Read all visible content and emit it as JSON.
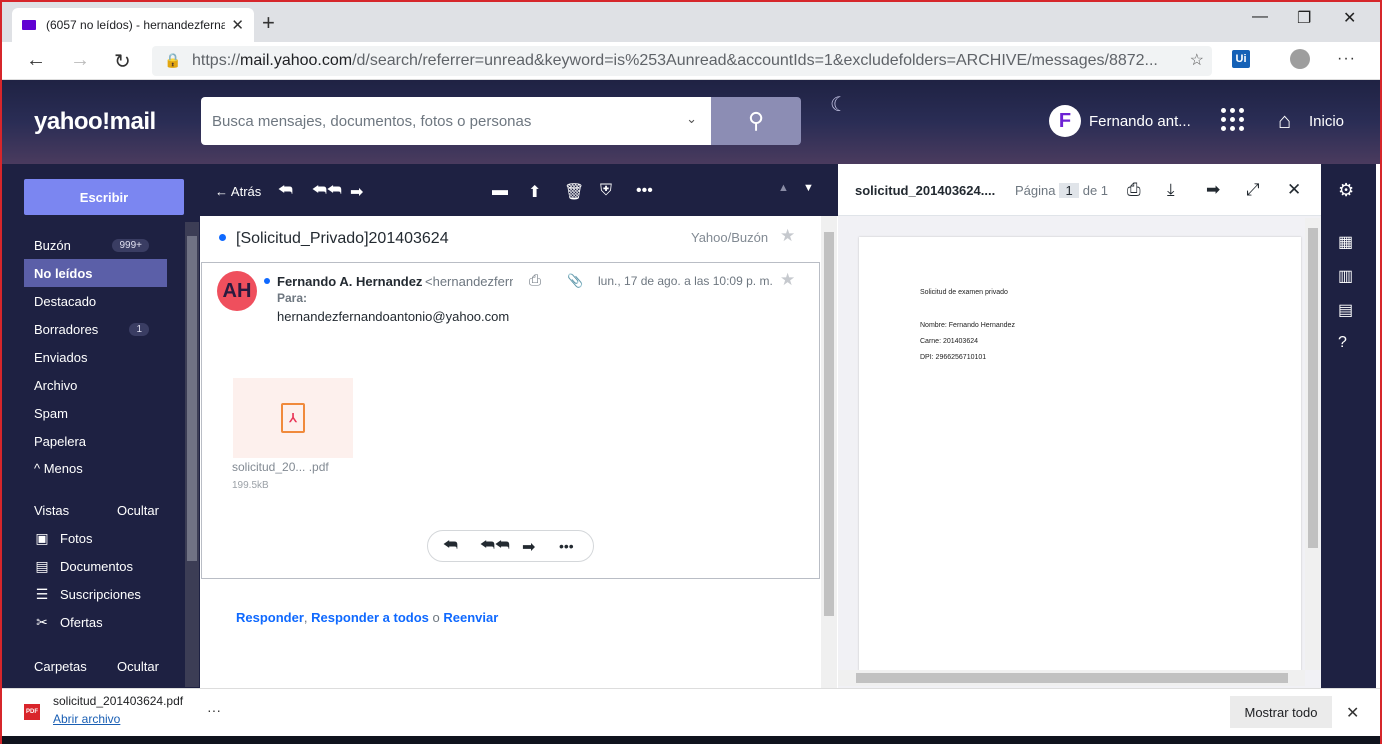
{
  "browser": {
    "tab_title": "(6057 no leídos) - hernandezferna",
    "url_prefix": "https://",
    "url_host": "mail.yahoo.com",
    "url_path": "/d/search/referrer=unread&keyword=is%253Aunread&accountIds=1&excludefolders=ARCHIVE/messages/8872...",
    "ext_label": "Ui"
  },
  "header": {
    "logo": "yahoo!mail",
    "search_placeholder": "Busca mensajes, documentos, fotos o personas",
    "user_name": "Fernando ant...",
    "user_initial": "F",
    "home_label": "Inicio"
  },
  "sidebar": {
    "compose": "Escribir",
    "folders": [
      {
        "label": "Buzón",
        "count": "999+"
      },
      {
        "label": "No leídos",
        "count": ""
      },
      {
        "label": "Destacado",
        "count": ""
      },
      {
        "label": "Borradores",
        "count": "1"
      },
      {
        "label": "Enviados",
        "count": ""
      },
      {
        "label": "Archivo",
        "count": ""
      },
      {
        "label": "Spam",
        "count": ""
      },
      {
        "label": "Papelera",
        "count": ""
      }
    ],
    "less": "^ Menos",
    "views_label": "Vistas",
    "hide_label": "Ocultar",
    "views": [
      {
        "label": "Fotos"
      },
      {
        "label": "Documentos"
      },
      {
        "label": "Suscripciones"
      },
      {
        "label": "Ofertas"
      }
    ],
    "folders_label": "Carpetas",
    "folders_hide": "Ocultar"
  },
  "toolbar": {
    "back": "Atrás"
  },
  "message": {
    "subject": "[Solicitud_Privado]201403624",
    "folder": "Yahoo/Buzón",
    "sender_name": "Fernando A. Hernandez",
    "sender_email": "<hernandezfernandoantonio@yahoo.com>",
    "to_label": "Para:",
    "to_address": "hernandezfernandoantonio@yahoo.com",
    "date": "lun., 17 de ago. a las 10:09 p. m.",
    "avatar_initials": "AH",
    "attachment_name": "solicitud_20... .pdf",
    "attachment_size": "199.5kB",
    "reply": "Responder",
    "reply_all": "Responder a todos",
    "or": " o ",
    "forward": "Reenviar",
    "comma": ", "
  },
  "viewer": {
    "title": "solicitud_201403624....",
    "page_label": "Página",
    "page_num": "1",
    "page_of": "de 1",
    "doc_lines": [
      "Solicitud de examen privado",
      "Nombre: Fernando Hernandez",
      "Carne: 201403624",
      "DPI: 2966256710101"
    ]
  },
  "downloads": {
    "file": "solicitud_201403624.pdf",
    "open": "Abrir archivo",
    "show_all": "Mostrar todo",
    "pdf_badge": "PDF"
  }
}
